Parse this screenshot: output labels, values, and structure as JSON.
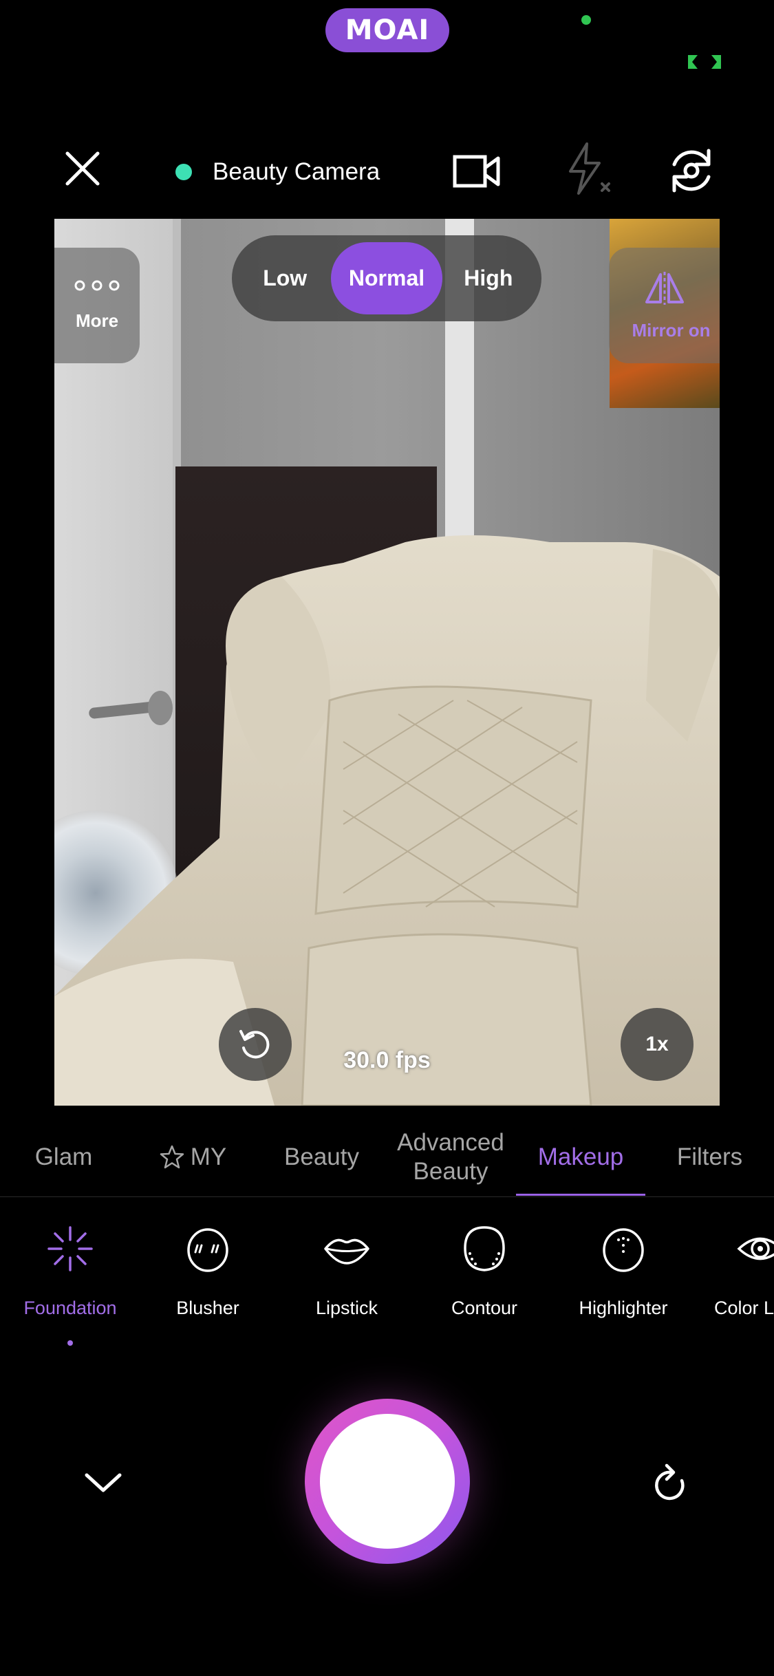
{
  "status_bar": {
    "app_pill": "MOAI",
    "indicator_dot_color": "#30c552"
  },
  "top_bar": {
    "close_icon": "close-icon",
    "mode_label": "Beauty Camera",
    "mode_dot_color": "#3de0b4",
    "video_icon": "video-camera-icon",
    "flash_icon": "flash-off-icon",
    "switch_camera_icon": "switch-camera-icon"
  },
  "viewfinder": {
    "more_label": "More",
    "intensity_options": [
      "Low",
      "Normal",
      "High"
    ],
    "intensity_selected": "Normal",
    "mirror_label": "Mirror on",
    "fps_label": "30.0 fps",
    "zoom_label": "1x"
  },
  "tabs": [
    {
      "label": "Glam"
    },
    {
      "label": "MY",
      "icon": "star-outline-icon"
    },
    {
      "label": "Beauty"
    },
    {
      "label": "Advanced Beauty"
    },
    {
      "label": "Makeup",
      "active": true
    },
    {
      "label": "Filters"
    }
  ],
  "tools": [
    {
      "label": "Foundation",
      "icon": "sparkle-icon",
      "active": true
    },
    {
      "label": "Blusher",
      "icon": "blush-face-icon"
    },
    {
      "label": "Lipstick",
      "icon": "lips-icon"
    },
    {
      "label": "Contour",
      "icon": "contour-face-icon"
    },
    {
      "label": "Highlighter",
      "icon": "highlighter-face-icon"
    },
    {
      "label": "Color L",
      "icon": "eye-icon"
    }
  ],
  "bottom_bar": {
    "collapse_icon": "chevron-down-icon",
    "shutter": "shutter-button",
    "reset_icon": "rotate-right-icon"
  },
  "colors": {
    "accent": "#8c4fe0",
    "accent_text": "#a26ee8",
    "shutter_gradient": [
      "#e056c8",
      "#8d58ee"
    ]
  }
}
